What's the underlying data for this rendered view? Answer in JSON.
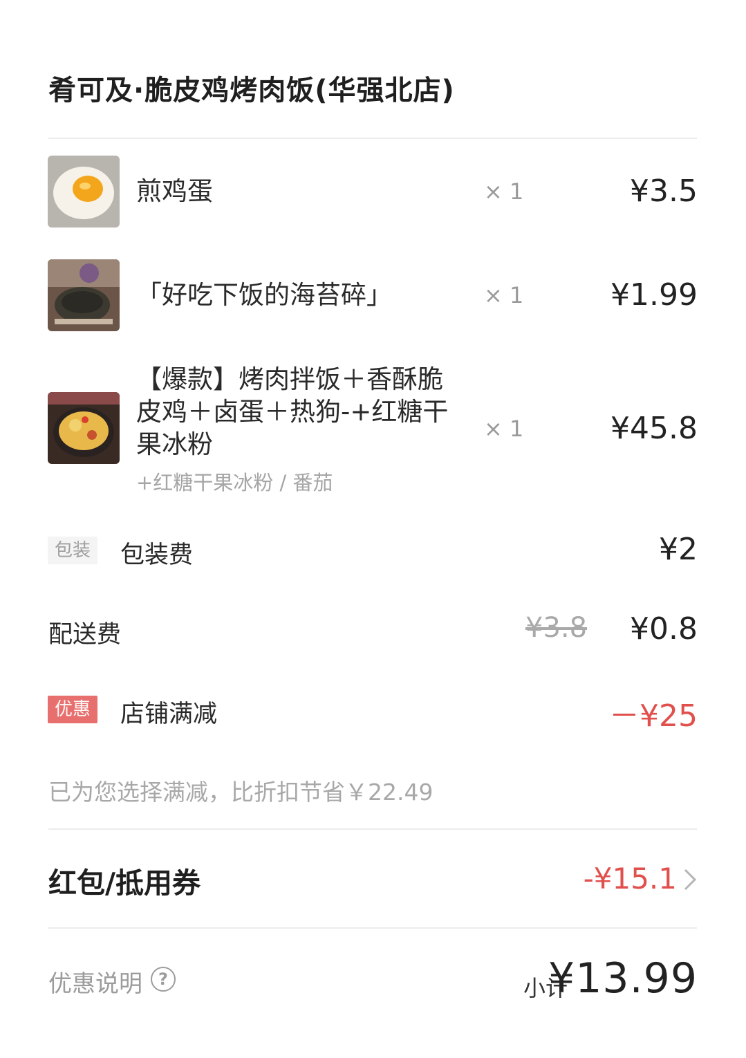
{
  "store": {
    "name": "肴可及·脆皮鸡烤肉饭(华强北店)"
  },
  "items": [
    {
      "name": "煎鸡蛋",
      "qty": "× 1",
      "price": "¥3.5",
      "thumb_icon": "fried-egg-image"
    },
    {
      "name": "「好吃下饭的海苔碎」",
      "qty": "× 1",
      "price": "¥1.99",
      "thumb_icon": "seaweed-image"
    },
    {
      "name_lines": [
        "【爆款】烤肉拌饭＋香酥脆",
        "皮鸡＋卤蛋＋热狗-+红糖干",
        "果冰粉"
      ],
      "spec": "+红糖干果冰粉 / 番茄",
      "qty": "× 1",
      "price": "¥45.8",
      "thumb_icon": "rice-bowl-image"
    }
  ],
  "packaging": {
    "tag": "包装",
    "label": "包装费",
    "price": "¥2"
  },
  "delivery": {
    "label": "配送费",
    "original": "¥3.8",
    "price": "¥0.8"
  },
  "discount": {
    "tag": "优惠",
    "label": "店铺满减",
    "amount": "－¥25"
  },
  "hint": "已为您选择满减，比折扣节省￥22.49",
  "coupon": {
    "label": "红包/抵用券",
    "amount": "-¥15.1"
  },
  "footer": {
    "explain": "优惠说明",
    "help_glyph": "?",
    "subtotal_label": "小计",
    "subtotal": "¥13.99"
  },
  "colors": {
    "accent_red": "#e0504c",
    "tag_red": "#e7706f"
  }
}
